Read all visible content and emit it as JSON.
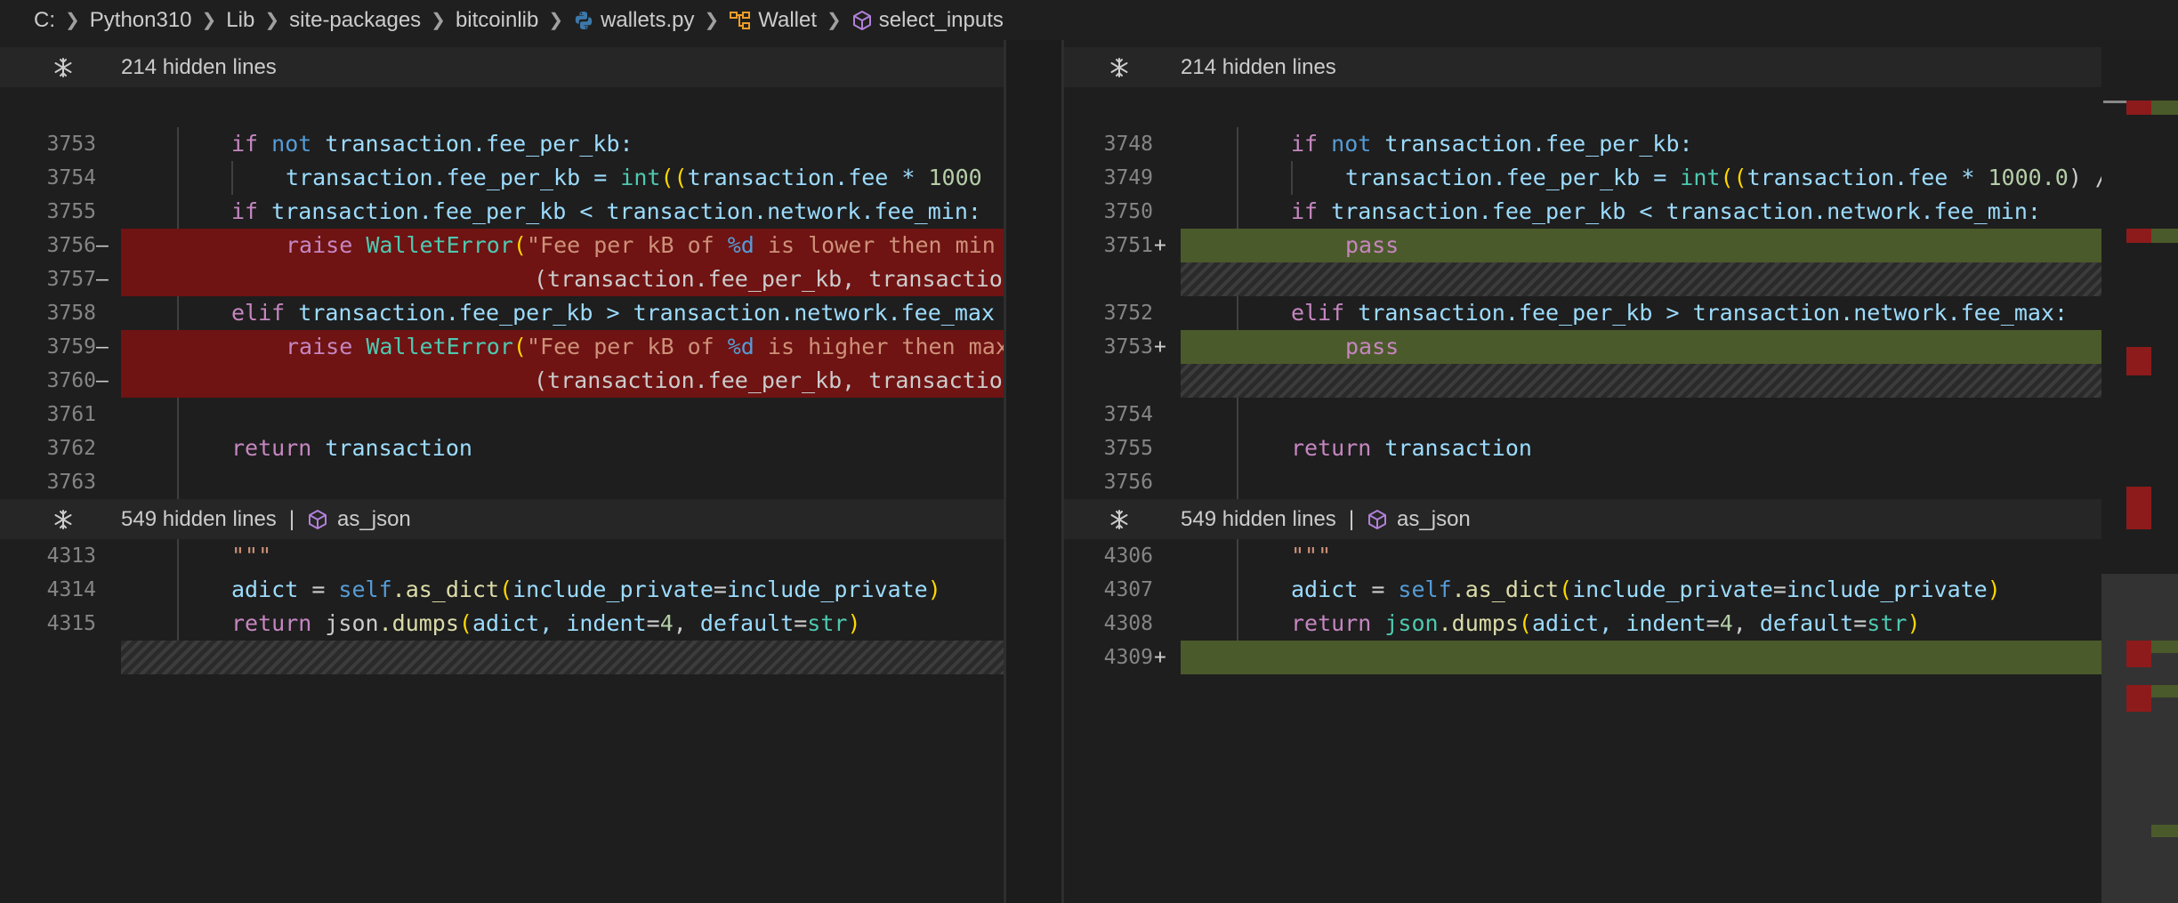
{
  "breadcrumb": {
    "items": [
      "C:",
      "Python310",
      "Lib",
      "site-packages",
      "bitcoinlib",
      "wallets.py",
      "Wallet",
      "select_inputs"
    ],
    "file_icon": "python-file-icon",
    "class_icon": "class-icon",
    "method_icon": "method-cube-icon"
  },
  "left": {
    "fold1": {
      "text": "214 hidden lines"
    },
    "fold2": {
      "text": "549 hidden lines",
      "symbol": "as_json"
    },
    "lines": {
      "l3753": "3753",
      "l3754": "3754",
      "l3755": "3755",
      "l3756": "3756",
      "l3757": "3757",
      "l3758": "3758",
      "l3759": "3759",
      "l3760": "3760",
      "l3761": "3761",
      "l3762": "3762",
      "l3763": "3763",
      "l4313": "4313",
      "l4314": "4314",
      "l4315": "4315"
    },
    "marker_del": "—"
  },
  "right": {
    "fold1": {
      "text": "214 hidden lines"
    },
    "fold2": {
      "text": "549 hidden lines",
      "symbol": "as_json"
    },
    "lines": {
      "l3748": "3748",
      "l3749": "3749",
      "l3750": "3750",
      "l3751": "3751",
      "l3752": "3752",
      "l3753": "3753",
      "l3754": "3754",
      "l3755": "3755",
      "l3756": "3756",
      "l4306": "4306",
      "l4307": "4307",
      "l4308": "4308",
      "l4309": "4309"
    },
    "marker_add": "+"
  },
  "code": {
    "t_if": "if",
    "t_not": "not",
    "t_elif": "elif",
    "t_raise": "raise",
    "t_return": "return",
    "t_pass": "pass",
    "t_transaction": "transaction",
    "t_fee_per_kb_attr": ".fee_per_kb:",
    "t_fee_per_kb_assign": ".fee_per_kb = ",
    "t_int": "int",
    "t_open2": "((",
    "t_fee_mul_left": ".fee * ",
    "t_1000_left": "1000",
    "t_1000_right": "1000.0",
    "t_close_div": ") /",
    "t_fee_per_kb_lt": ".fee_per_kb < ",
    "t_fee_per_kb_gt": ".fee_per_kb > ",
    "t_network_min_left": ".network.fee_min:",
    "t_network_max_left": ".network.fee_max",
    "t_network_min_right": ".network.fee_min:",
    "t_network_max_right": ".network.fee_max:",
    "t_walleterror": "WalletError",
    "t_paren_open": "(",
    "t_str_lower_a": "\"Fee per kB of ",
    "t_str_fmt": "%d",
    "t_str_lower_b": " is lower then min",
    "t_str_higher_b": " is higher then max",
    "t_args_cont": "(transaction.fee_per_kb, transaction.",
    "t_docstring": "\"\"\"",
    "t_adict": "adict",
    "t_eq": " = ",
    "t_self": "self",
    "t_as_dict": ".as_dict",
    "t_include_private": "include_private",
    "t_kw_eq": "=",
    "t_close_paren": ")",
    "t_json": "json",
    "t_dumps": ".dumps",
    "t_adict_comma": "adict, ",
    "t_indent": "indent",
    "t_eq4": "=",
    "t_4": "4",
    "t_comma_sp": ", ",
    "t_default": "default",
    "t_str_type": "str"
  },
  "colors": {
    "deleted_line": "#6f1313",
    "inserted_line": "#4b5a2a",
    "keyword": "#c586c0",
    "builtin": "#569cd6",
    "variable": "#9cdcfe",
    "function": "#dcdcaa",
    "class": "#4ec9b0",
    "string": "#ce9178",
    "number": "#b5cea8"
  }
}
